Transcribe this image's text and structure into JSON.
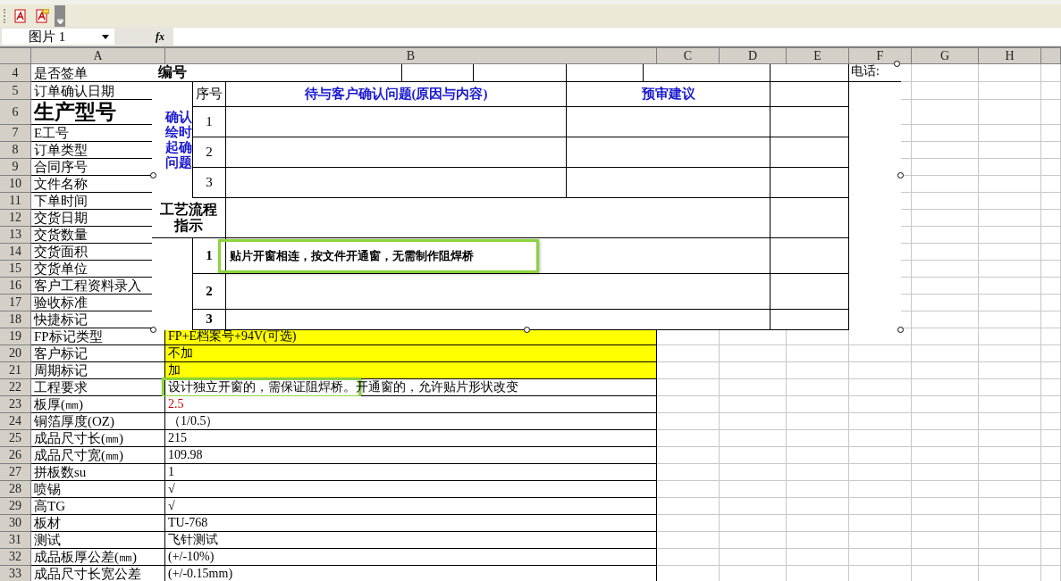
{
  "formula_bar": {
    "name_box": "图片 1",
    "fx": "fx"
  },
  "columns": [
    "A",
    "B",
    "C",
    "D",
    "E",
    "F",
    "G",
    "H"
  ],
  "rows": [
    {
      "number": "4",
      "label": "是否签单",
      "kind": "plain"
    },
    {
      "number": "5",
      "label": "订单确认日期",
      "kind": "plain"
    },
    {
      "number": "6",
      "label": "生产型号",
      "kind": "heading"
    },
    {
      "number": "7",
      "label": "E工号",
      "kind": "plain"
    },
    {
      "number": "8",
      "label": "订单类型",
      "kind": "plain"
    },
    {
      "number": "9",
      "label": "合同序号",
      "kind": "plain"
    },
    {
      "number": "10",
      "label": "文件名称",
      "kind": "plain"
    },
    {
      "number": "11",
      "label": "下单时间",
      "kind": "plain"
    },
    {
      "number": "12",
      "label": "交货日期",
      "kind": "plain"
    },
    {
      "number": "13",
      "label": "交货数量",
      "kind": "plain"
    },
    {
      "number": "14",
      "label": "交货面积",
      "kind": "plain"
    },
    {
      "number": "15",
      "label": "交货单位",
      "kind": "plain"
    },
    {
      "number": "16",
      "label": "客户工程资料录入",
      "kind": "plain"
    },
    {
      "number": "17",
      "label": "验收标准",
      "kind": "plain"
    },
    {
      "number": "18",
      "label": "快捷标记",
      "kind": "plain"
    },
    {
      "number": "19",
      "label": "FP标记类型",
      "kind": "plain",
      "value": "FP+E档案号+94V(可选)",
      "highlighted": true,
      "marked": false
    },
    {
      "number": "20",
      "label": "客户标记",
      "kind": "plain",
      "value": "不加",
      "highlighted": true,
      "marked": false
    },
    {
      "number": "21",
      "label": "周期标记",
      "kind": "plain",
      "value": "加",
      "highlighted": true,
      "marked": false
    },
    {
      "number": "22",
      "label": "工程要求",
      "kind": "plain",
      "value": "设计独立开窗的，需保证阻焊桥。开通窗的，允许贴片形状改变",
      "highlighted": false,
      "marked": true
    },
    {
      "number": "23",
      "label": "板厚(㎜)",
      "kind": "plain",
      "value": "2.5",
      "highlighted": false,
      "marked": false,
      "color": "#cc0000"
    },
    {
      "number": "24",
      "label": "铜箔厚度(OZ)",
      "kind": "plain",
      "value": "（1/0.5）",
      "highlighted": false,
      "marked": false
    },
    {
      "number": "25",
      "label": "成品尺寸长(㎜)",
      "kind": "plain",
      "value": "215",
      "highlighted": false,
      "marked": false
    },
    {
      "number": "26",
      "label": "成品尺寸宽(㎜)",
      "kind": "plain",
      "value": "109.98",
      "highlighted": false,
      "marked": false
    },
    {
      "number": "27",
      "label": "拼板数su",
      "kind": "plain",
      "value": "1",
      "highlighted": false,
      "marked": false
    },
    {
      "number": "28",
      "label": "喷锡",
      "kind": "plain",
      "value": "√",
      "highlighted": false,
      "marked": false
    },
    {
      "number": "29",
      "label": "高TG",
      "kind": "plain",
      "value": "√",
      "highlighted": false,
      "marked": false
    },
    {
      "number": "30",
      "label": "板材",
      "kind": "plain",
      "value": "TU-768",
      "highlighted": false,
      "marked": false
    },
    {
      "number": "31",
      "label": "测试",
      "kind": "plain",
      "value": "飞针测试",
      "highlighted": false,
      "marked": false
    },
    {
      "number": "32",
      "label": "成品板厚公差(㎜)",
      "kind": "plain",
      "value": "(+/-10%)",
      "highlighted": false,
      "marked": false
    },
    {
      "number": "33",
      "label": "成品尺寸长宽公差",
      "kind": "plain",
      "value": "(+/-0.15mm)",
      "highlighted": false,
      "marked": false
    }
  ],
  "embedded_sheet": {
    "id_label": "编号",
    "phone_label": "电话:",
    "side_note": [
      "确认",
      "绘时",
      "起确",
      "问题"
    ],
    "header": {
      "index": "序号",
      "question": "待与客户确认问题(原因与内容)",
      "suggestion": "预审建议"
    },
    "question_rows": [
      "1",
      "2",
      "3"
    ],
    "process_label": [
      "工艺流程",
      "指示"
    ],
    "process_rows": [
      {
        "index": "1",
        "text": "贴片开窗相连，按文件开通窗，无需制作阻焊桥",
        "marked": true
      },
      {
        "index": "2",
        "marked": false
      },
      {
        "index": "3",
        "marked": false
      }
    ]
  }
}
